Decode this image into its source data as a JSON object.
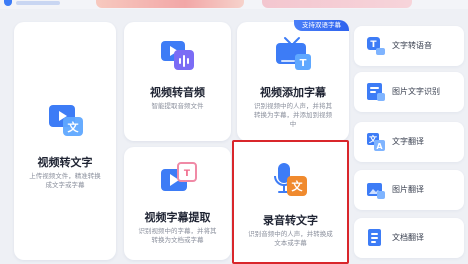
{
  "cards": {
    "video_to_text": {
      "title": "视频转文字",
      "desc": "上传视频文件，精准转换成文字或字幕"
    },
    "video_to_audio": {
      "title": "视频转音频",
      "desc": "智能提取音频文件"
    },
    "video_add_subtitle": {
      "title": "视频添加字幕",
      "desc": "识别视频中的人声，并将其转换为字幕，并添加到视频中",
      "badge": "支持双语字幕"
    },
    "video_subtitle_extract": {
      "title": "视频字幕提取",
      "desc": "识别视频中的字幕，并将其转换为文档或字幕"
    },
    "audio_to_text": {
      "title": "录音转文字",
      "desc": "识别音频中的人声，并转换成文本或字幕"
    }
  },
  "sidebar": {
    "items": [
      {
        "label": "文字转语音",
        "icon": "text-to-speech-icon"
      },
      {
        "label": "图片文字识别",
        "icon": "image-ocr-icon"
      },
      {
        "label": "文字翻译",
        "icon": "text-translate-icon"
      },
      {
        "label": "图片翻译",
        "icon": "image-translate-icon"
      },
      {
        "label": "文档翻译",
        "icon": "document-translate-icon"
      }
    ]
  },
  "colors": {
    "accent": "#3d7cf6",
    "orange": "#f08a2e",
    "highlight": "#d9262b"
  }
}
